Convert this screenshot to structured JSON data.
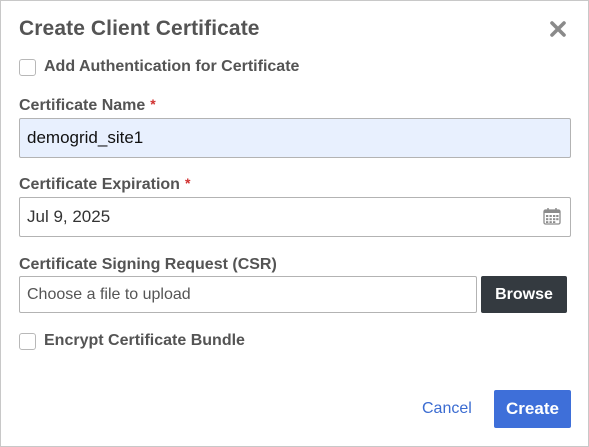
{
  "dialog": {
    "title": "Create Client Certificate",
    "close_icon": "close-icon"
  },
  "auth_checkbox": {
    "label": "Add Authentication for Certificate",
    "checked": false
  },
  "cert_name": {
    "label": "Certificate Name",
    "required_mark": "*",
    "value": "demogrid_site1"
  },
  "cert_expiration": {
    "label": "Certificate Expiration",
    "required_mark": "*",
    "value": "Jul 9, 2025",
    "icon": "calendar-icon"
  },
  "csr": {
    "label": "Certificate Signing Request (CSR)",
    "placeholder": "Choose a file to upload",
    "browse_label": "Browse"
  },
  "encrypt_checkbox": {
    "label": "Encrypt Certificate Bundle",
    "checked": false
  },
  "footer": {
    "cancel_label": "Cancel",
    "create_label": "Create"
  },
  "colors": {
    "primary": "#3e6fd9",
    "dark_button": "#343a40",
    "required": "#d0302f",
    "autofill_bg": "#e8f0fe"
  }
}
